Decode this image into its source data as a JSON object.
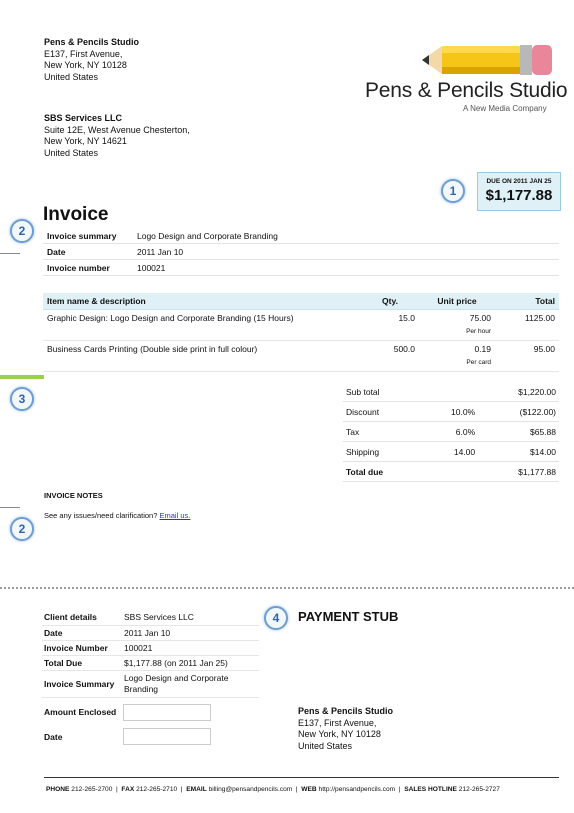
{
  "sender": {
    "name": "Pens & Pencils Studio",
    "line1": "E137, First Avenue,",
    "line2": "New York, NY 10128",
    "line3": "United States"
  },
  "logo": {
    "title": "Pens & Pencils Studio",
    "subtitle": "A New Media Company"
  },
  "recipient": {
    "name": "SBS Services LLC",
    "line1": "Suite 12E, West Avenue Chesterton,",
    "line2": "New York, NY 14621",
    "line3": "United States"
  },
  "due": {
    "label": "DUE ON 2011 JAN 25",
    "amount": "$1,177.88"
  },
  "markers": [
    "1",
    "2",
    "3",
    "2",
    "4"
  ],
  "invoice": {
    "title": "Invoice",
    "summary_label": "Invoice summary",
    "summary_value": "Logo Design and Corporate Branding",
    "date_label": "Date",
    "date_value": "2011 Jan 10",
    "number_label": "Invoice number",
    "number_value": "100021"
  },
  "items": {
    "headers": {
      "desc": "Item name & description",
      "qty": "Qty.",
      "unit": "Unit price",
      "total": "Total"
    },
    "rows": [
      {
        "desc": "Graphic Design: Logo Design and Corporate Branding (15 Hours)",
        "qty": "15.0",
        "unit": "75.00",
        "unit_note": "Per hour",
        "total": "1125.00"
      },
      {
        "desc": "Business Cards Printing (Double side print in full colour)",
        "qty": "500.0",
        "unit": "0.19",
        "unit_note": "Per card",
        "total": "95.00"
      }
    ]
  },
  "totals": [
    {
      "label": "Sub total",
      "rate": "",
      "amount": "$1,220.00"
    },
    {
      "label": "Discount",
      "rate": "10.0%",
      "amount": "($122.00)"
    },
    {
      "label": "Tax",
      "rate": "6.0%",
      "amount": "$65.88"
    },
    {
      "label": "Shipping",
      "rate": "14.00",
      "amount": "$14.00"
    },
    {
      "label": "Total due",
      "rate": "",
      "amount": "$1,177.88"
    }
  ],
  "notes": {
    "heading": "INVOICE NOTES",
    "text": "See any issues/need clarification?",
    "link": "Email us."
  },
  "stub": {
    "title": "PAYMENT STUB",
    "client_label": "Client details",
    "client_value": "SBS Services LLC",
    "date_label": "Date",
    "date_value": "2011 Jan 10",
    "number_label": "Invoice Number",
    "number_value": "100021",
    "total_label": "Total Due",
    "total_value": "$1,177.88 (on 2011 Jan 25)",
    "summary_label": "Invoice Summary",
    "summary_value": "Logo Design and Corporate Branding",
    "amount_label": "Amount Enclosed",
    "date2_label": "Date"
  },
  "footer": {
    "phone_label": "PHONE",
    "phone": "212-265-2700",
    "fax_label": "FAX",
    "fax": "212-265-2710",
    "email_label": "EMAIL",
    "email": "billing@pensandpencils.com",
    "web_label": "WEB",
    "web": "http://pensandpencils.com",
    "hotline_label": "SALES HOTLINE",
    "hotline": "212-265-2727"
  },
  "colors": {
    "accent_bg": "#dff0f7",
    "marker": "#6f9dcf",
    "green_bar": "#9ad04a",
    "pencil": "#f5c518"
  }
}
